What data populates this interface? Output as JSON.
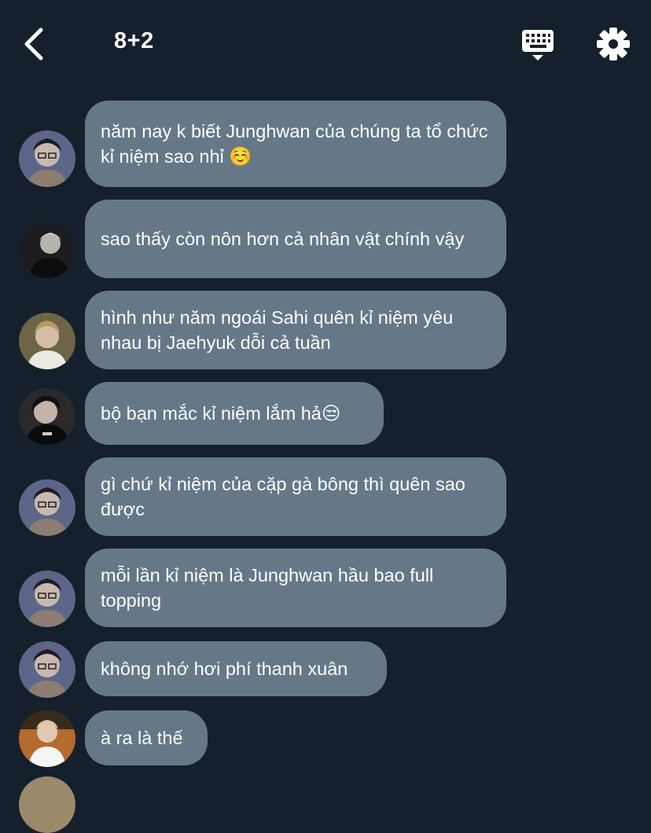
{
  "header": {
    "title": "8+2",
    "back_icon": "chevron-left-icon",
    "keyboard_icon": "keyboard-icon",
    "settings_icon": "gear-icon"
  },
  "messages": [
    {
      "text": "năm nay k biết Junghwan của chúng ta tổ chức kỉ niệm sao nhỉ ",
      "emoji": "☺️"
    },
    {
      "text": "sao thấy còn nôn hơn cả nhân vật chính vậy"
    },
    {
      "text": "hình như năm ngoái Sahi quên kỉ niệm yêu nhau bị Jaehyuk dỗi cả tuần"
    },
    {
      "text": "bộ bạn mắc kỉ niệm lắm hả",
      "emoji": "😒"
    },
    {
      "text": "gì chứ kỉ niệm của cặp gà bông thì quên sao được"
    },
    {
      "text": "mỗi lần kỉ niệm là Junghwan hầu bao full topping"
    },
    {
      "text": "không nhớ hơi phí thanh xuân"
    },
    {
      "text": "à ra là thế"
    }
  ],
  "colors": {
    "background": "#16202c",
    "bubble": "#667788",
    "text": "#ffffff"
  }
}
